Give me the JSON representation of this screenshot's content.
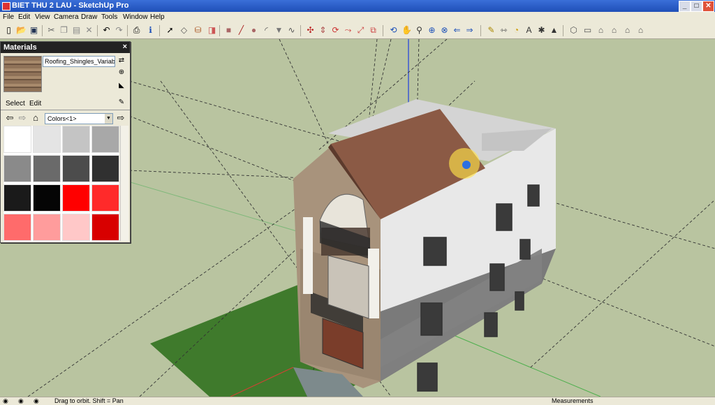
{
  "window": {
    "title": "BIET THU 2 LAU - SketchUp Pro",
    "minimize": "_",
    "maximize": "□",
    "close": "✕"
  },
  "menu": [
    "File",
    "Edit",
    "View",
    "Camera",
    "Draw",
    "Tools",
    "Window",
    "Help"
  ],
  "toolbar_icons": [
    "new",
    "open",
    "save",
    "cut",
    "copy",
    "paste",
    "erase",
    "undo",
    "redo",
    "print",
    "model-info",
    "select",
    "make-component",
    "paint-bucket",
    "eraser",
    "rectangle",
    "line",
    "circle",
    "arc",
    "polygon",
    "freehand",
    "move",
    "push-pull",
    "rotate",
    "follow-me",
    "scale",
    "offset",
    "orbit",
    "pan",
    "zoom",
    "zoom-window",
    "zoom-extents",
    "previous",
    "tape-measure",
    "dimension",
    "protractor",
    "text",
    "axes",
    "3d-text",
    "iso",
    "top",
    "front",
    "right",
    "back",
    "left"
  ],
  "materials": {
    "title": "Materials",
    "close": "×",
    "material_name": "Roofing_Shingles_Variab",
    "tabs": [
      "Select",
      "Edit"
    ],
    "collection": "Colors<1>",
    "swatches": [
      "#ffffff",
      "#e4e4e4",
      "#c4c4c4",
      "#a8a8a8",
      "#8a8a8a",
      "#6a6a6a",
      "#4c4c4c",
      "#303030",
      "#1a1a1a",
      "#050505",
      "#ff0000",
      "#ff2a2a",
      "#ff6b6b",
      "#ff9c9c",
      "#ffc8c8",
      "#d80000"
    ]
  },
  "status": {
    "hint": "Drag to orbit.  Shift = Pan",
    "measurements_label": "Measurements"
  }
}
